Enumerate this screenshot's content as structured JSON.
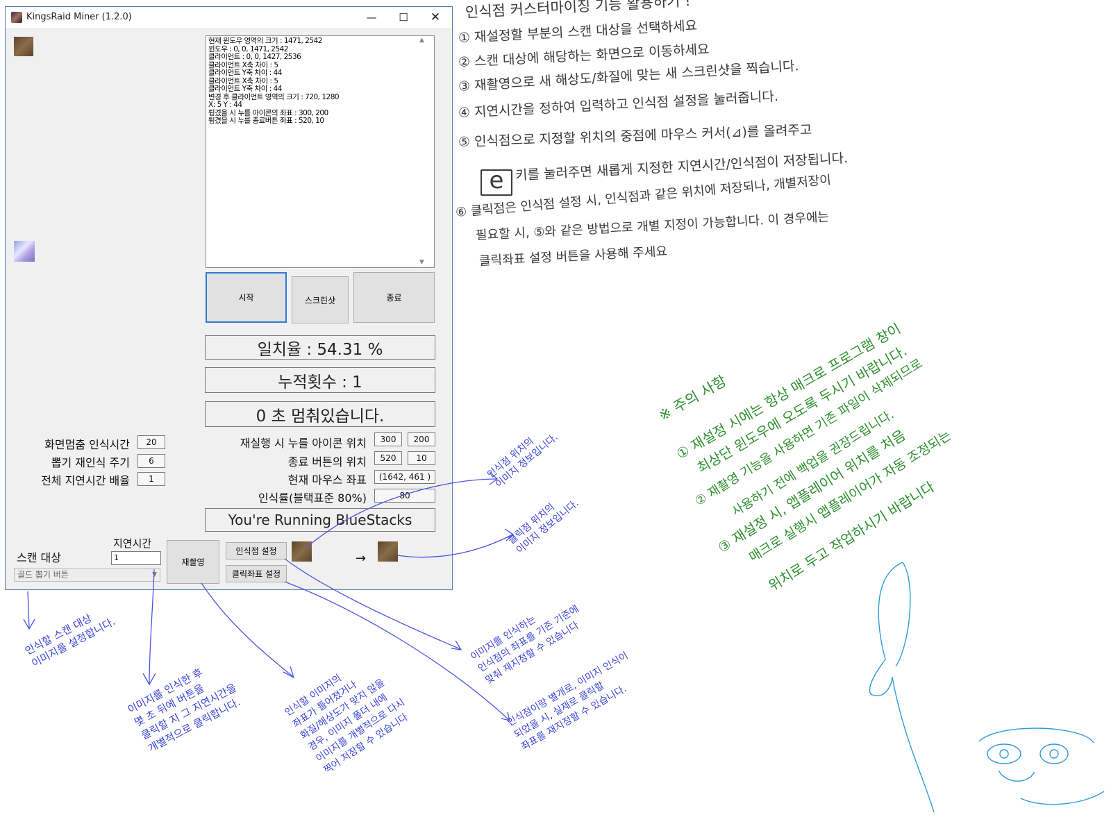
{
  "window": {
    "title": "KingsRaid Miner (1.2.0)",
    "log_lines": [
      "현재 윈도우 영역의 크기 : 1471, 2542",
      "윈도우 : 0, 0, 1471, 2542",
      "클라이언트 : 0, 0, 1427, 2536",
      "클라이언트 X축 차이 : 5",
      "클라이언트 Y축 차이 : 44",
      "클라이언트 X축 차이 : 5",
      "클라이언트 Y축 차이 : 44",
      "변경 후 클라이언트 영역의 크기 : 720, 1280",
      "X: 5 Y : 44",
      "튕겼을 시 누를 아이콘의 좌표 : 300, 200",
      "튕겼을 시 누를 종료버튼 좌표 : 520, 10"
    ],
    "buttons": {
      "start": "시작",
      "screenshot": "스크린샷",
      "end": "종료",
      "reshoot": "재촬영",
      "rec_point": "인식점 설정",
      "click_point": "클릭좌표 설정"
    },
    "status": {
      "match": "일치율 : 54.31 %",
      "count": "누적횟수 : 1",
      "pause": "0 초 멈춰있습니다.",
      "emulator": "You're Running BlueStacks"
    },
    "left_settings": [
      {
        "label": "화면멈춤 인식시간",
        "value": "20"
      },
      {
        "label": "뽑기 재인식 주기",
        "value": "6"
      },
      {
        "label": "전체 지연시간 배율",
        "value": "1"
      }
    ],
    "right_settings": {
      "restart_icon": {
        "label": "재실행 시 누를 아이콘 위치",
        "x": "300",
        "y": "200"
      },
      "end_button": {
        "label": "종료 버튼의 위치",
        "x": "520",
        "y": "10"
      },
      "mouse": {
        "label": "현재 마우스 좌표",
        "value": "(1642, 461 )"
      },
      "rate": {
        "label": "인식률(블택표준 80%)",
        "value": "80"
      }
    },
    "scan": {
      "label": "스캔 대상",
      "selected": "골드 뽑기 버튼",
      "delay_label": "지연시간",
      "delay_value": "1"
    },
    "arrow": "→"
  },
  "annotations": {
    "title": "인식점 커스터마이징 기능 활용하기 !",
    "steps": [
      "① 재설정할 부분의 스캔 대상을 선택하세요",
      "② 스캔 대상에 해당하는 화면으로 이동하세요",
      "③ 재촬영으로 새 해상도/화질에 맞는 새 스크린샷을 찍습니다.",
      "④ 지연시간을 정하여 입력하고 인식점 설정을 눌러줍니다.",
      "⑤ 인식점으로 지정할 위치의 중점에 마우스 커서(⊿)를 올려주고",
      "키를 눌러주면 새롭게 지정한 지연시간/인식점이 저장됩니다.",
      "⑥ 클릭점은 인식점 설정 시, 인식점과 같은 위치에 저장되나, 개별저장이",
      "필요할 시, ⑤와 같은 방법으로 개별 지정이 가능합니다. 이 경우에는",
      "클릭좌표 설정 버튼을 사용해 주세요"
    ],
    "e_key": "e",
    "caution": [
      "※ 주의 사항",
      "① 재설정 시에는 항상 매크로 프로그램 창이",
      "최상단 윈도우에 오도록 두시기 바랍니다.",
      "② 재촬영 기능을 사용하면 기존 파일이 삭제되므로",
      "사용하기 전에 백업을 권장드립니다.",
      "③ 재설정 시, 앱플레이어 위치를 처음",
      "매크로 실행시 앱플레이어가 자동 조정되는",
      "위치로 두고 작업하시기 바랍니다"
    ],
    "blue_notes": {
      "rec_image": [
        "인식점 위치의",
        "이미지 정보입니다."
      ],
      "click_image": [
        "클릭점 위치의",
        "이미지 정보입니다."
      ],
      "scan_target": [
        "인식할 스캔 대상",
        "이미지를 설정합니다."
      ],
      "delay": [
        "이미지를 인식한 후",
        "몇 초 뒤에 버튼을",
        "클릭할 지 그 지연시간을",
        "개별적으로 클릭합니다."
      ],
      "reshoot": [
        "인식할 이미지의",
        "좌표가 틀어졌거나",
        "화질/해상도가 맞지 않을",
        "경우, 이미지 폴더 내에",
        "이미지를 개별적으로 다시",
        "찍어 저장할 수 있습니다"
      ],
      "rec_btn": [
        "이미지를 인식하는",
        "인식점의 좌표를 기존 기준에",
        "맞춰 재지정할 수 있습니다"
      ],
      "click_btn": [
        "인식점이랑 별개로, 이미지 인식이",
        "되었을 시, 실제로 클릭할",
        "좌표를 재지정할 수 있습니다."
      ]
    }
  }
}
